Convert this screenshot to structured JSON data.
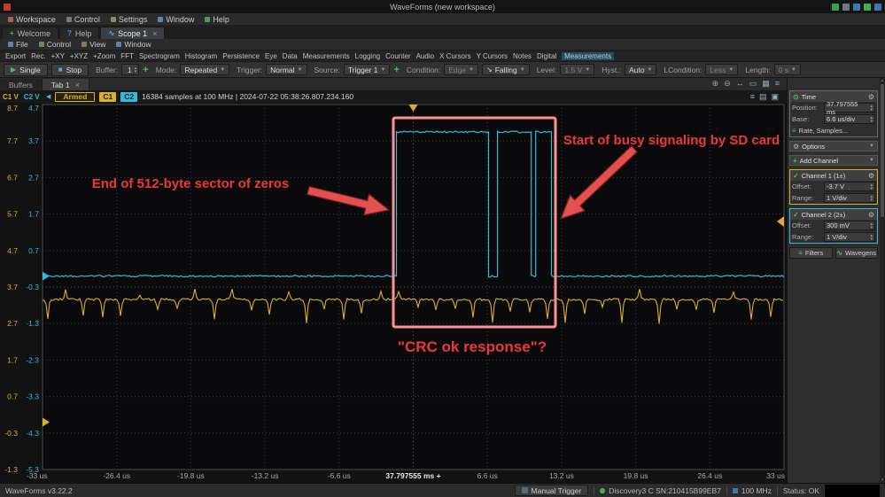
{
  "titlebar": {
    "title": "WaveForms (new workspace)"
  },
  "menubar": {
    "items": [
      "Workspace",
      "Control",
      "Settings",
      "Window",
      "Help"
    ]
  },
  "tabbar": {
    "welcome": "Welcome",
    "help": "Help",
    "scope": "Scope 1"
  },
  "menubar2": {
    "items": [
      "File",
      "Control",
      "View",
      "Window"
    ]
  },
  "toolbar": {
    "items": [
      "Export",
      "Rec.",
      "+XY",
      "+XYZ",
      "+Zoom",
      "FFT",
      "Spectrogram",
      "Histogram",
      "Persistence",
      "Eye",
      "Data",
      "Measurements",
      "Logging",
      "Counter",
      "Audio",
      "X Cursors",
      "Y Cursors",
      "Notes",
      "Digital",
      "Measurements"
    ]
  },
  "controls": {
    "single": "Single",
    "stop": "Stop",
    "buffer_label": "Buffer:",
    "buffer_value": "1",
    "mode_label": "Mode:",
    "mode_value": "Repeated",
    "trigger_label": "Trigger:",
    "trigger_value": "Normal",
    "source_label": "Source:",
    "source_value": "Trigger 1",
    "condition_label": "Condition:",
    "type_value": "Edge",
    "condition_value": "Falling",
    "level_label": "Level:",
    "level_value": "1.5 V",
    "hyst_label": "Hyst.:",
    "hyst_value": "Auto",
    "lcondition_label": "LCondition:",
    "lcondition_value": "Less",
    "length_label": "Length:",
    "length_value": "0 s"
  },
  "buffers_bar": {
    "buffers_tab": "Buffers",
    "active_tab": "Tab 1"
  },
  "plot_header": {
    "c1_axis": "C1 V",
    "c2_axis": "C2 V",
    "status": "Armed",
    "c1": "C1",
    "c2": "C2",
    "info": "16384 samples at 100 MHz | 2024-07-22 05:38:26.807.234.160"
  },
  "axes": {
    "c1_labels": [
      "8.7",
      "7.7",
      "6.7",
      "5.7",
      "4.7",
      "3.7",
      "2.7",
      "1.7",
      "0.7",
      "-0.3",
      "-1.3"
    ],
    "c2_labels": [
      "4.7",
      "3.7",
      "2.7",
      "1.7",
      "0.7",
      "-0.3",
      "-1.3",
      "-2.3",
      "-3.3",
      "-4.3",
      "-5.3"
    ],
    "x_labels": [
      "-33 us",
      "-26.4 us",
      "-19.8 us",
      "-13.2 us",
      "-6.6 us",
      "37.797555 ms +",
      "6.6 us",
      "13.2 us",
      "19.8 us",
      "26.4 us",
      "33 us"
    ]
  },
  "annotations": {
    "end_sector": "End of 512-byte sector of zeros",
    "busy": "Start of busy signaling by SD card",
    "crc": "\"CRC ok response\"?",
    "color": "#e23b3b"
  },
  "right_panel": {
    "time_title": "Time",
    "position_label": "Position:",
    "position_value": "37.797555 ms",
    "base_label": "Base:",
    "base_value": "6.6 us/div",
    "rate_button": "Rate, Samples...",
    "options_title": "Options",
    "add_channel": "Add Channel",
    "ch1_title": "Channel 1 (1±)",
    "ch1_offset_label": "Offset:",
    "ch1_offset_value": "-3.7 V",
    "ch1_range_label": "Range:",
    "ch1_range_value": "1 V/div",
    "ch2_title": "Channel 2 (2±)",
    "ch2_offset_label": "Offset:",
    "ch2_offset_value": "300 mV",
    "ch2_range_label": "Range:",
    "ch2_range_value": "1 V/div",
    "filters_button": "Filters",
    "wavegens_button": "Wavegens"
  },
  "statusbar": {
    "version": "WaveForms v3.22.2",
    "manual_trigger": "Manual Trigger",
    "device": "Discovery3 C SN:210415B99EB7",
    "rate": "100 MHz",
    "status": "Status: OK"
  },
  "colors": {
    "c1": "#d9b02c",
    "c2": "#35b8dc",
    "armed": "#d9b02c",
    "annotation": "#e23b3b",
    "plot_bg": "#0a0a0c"
  },
  "chart_data": {
    "type": "line",
    "title": "Oscilloscope capture, 2 channels",
    "x_unit": "us",
    "x_range": [
      -33,
      33
    ],
    "x_center_absolute": "37.797555 ms",
    "grid_divisions": [
      10,
      10
    ],
    "channels": [
      {
        "name": "Channel 1",
        "color": "#d9b02c",
        "units": "V",
        "volts_per_div": 1,
        "offset_v": -3.7,
        "baseline_v": 3.36,
        "noise_vpp": 0.06,
        "spike_period_us": 1.65,
        "spike_depth_v_min": 0.2,
        "spike_depth_v_max": 0.7
      },
      {
        "name": "Channel 2",
        "color": "#35b8dc",
        "units": "V",
        "volts_per_div": 1,
        "offset_v": 0.3,
        "low_v": 0.0,
        "high_v": 3.95,
        "noise_vpp": 0.05,
        "segments_us": [
          [
            -33.0,
            -1.5,
            0
          ],
          [
            -1.5,
            6.7,
            1
          ],
          [
            6.7,
            7.5,
            0
          ],
          [
            7.5,
            10.5,
            1
          ],
          [
            10.5,
            10.9,
            0
          ],
          [
            10.9,
            12.3,
            1
          ],
          [
            12.3,
            33.0,
            0
          ]
        ]
      }
    ]
  }
}
